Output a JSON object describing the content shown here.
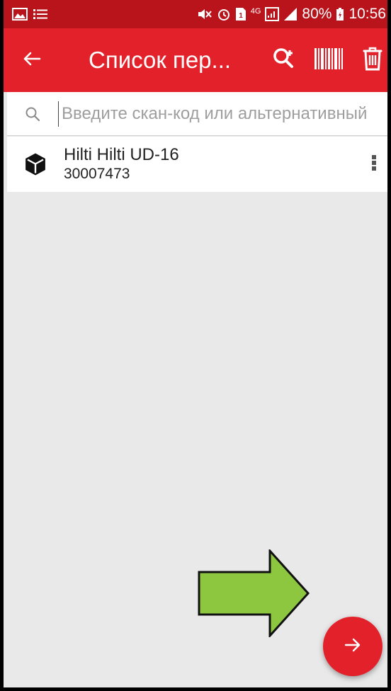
{
  "status_bar": {
    "network": "4G",
    "battery": "80%",
    "time": "10:56"
  },
  "app_bar": {
    "title": "Список пер...",
    "back_icon": "arrow-left-icon",
    "actions": [
      "search-add-icon",
      "barcode-icon",
      "trash-icon"
    ]
  },
  "search": {
    "placeholder": "Введите скан-код или альтернативный",
    "value": ""
  },
  "list": {
    "items": [
      {
        "name": "Hilti Hilti UD-16",
        "code": "30007473",
        "icon": "box-icon"
      }
    ]
  },
  "fab": {
    "icon": "arrow-right-icon"
  },
  "annotation": {
    "icon": "green-arrow-icon"
  },
  "colors": {
    "primary": "#e3212a",
    "status_bar": "#b9141b",
    "background": "#e9e9e9",
    "annotation_arrow": "#8dc63f"
  }
}
